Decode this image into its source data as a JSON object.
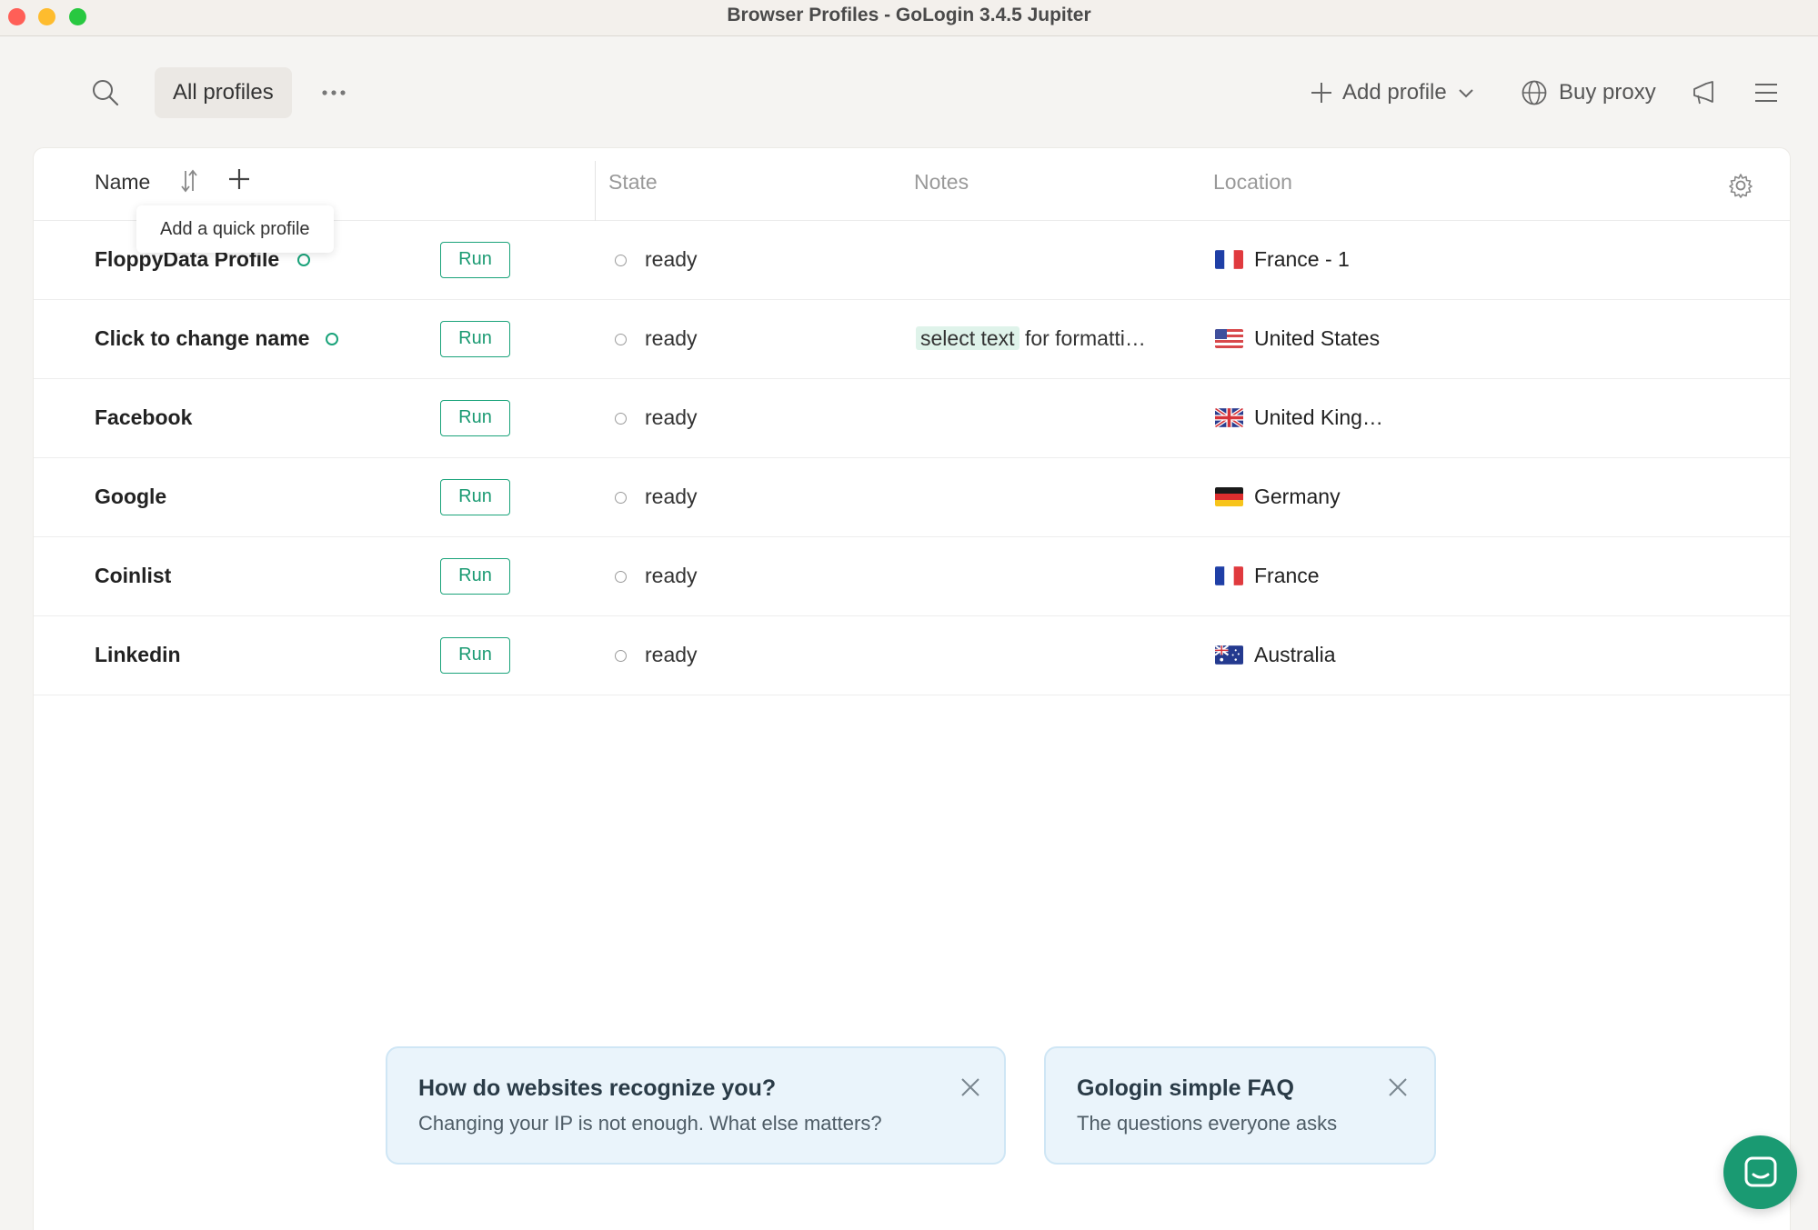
{
  "window": {
    "title": "Browser Profiles - GoLogin 3.4.5 Jupiter"
  },
  "toolbar": {
    "filter_label": "All profiles",
    "add_profile_label": "Add profile",
    "buy_proxy_label": "Buy proxy"
  },
  "table": {
    "columns": {
      "name": "Name",
      "state": "State",
      "notes": "Notes",
      "location": "Location"
    },
    "tooltip": "Add a quick profile",
    "rows": [
      {
        "name": "FloppyData Profile",
        "online": true,
        "run": "Run",
        "state": "ready",
        "notes_highlight": "",
        "notes_rest": "",
        "flag": "fr",
        "location": "France - 1"
      },
      {
        "name": "Click to change name",
        "online": true,
        "run": "Run",
        "state": "ready",
        "notes_highlight": "select text",
        "notes_rest": "for formatti…",
        "flag": "us",
        "location": "United States"
      },
      {
        "name": "Facebook",
        "online": false,
        "run": "Run",
        "state": "ready",
        "notes_highlight": "",
        "notes_rest": "",
        "flag": "gb",
        "location": "United King…"
      },
      {
        "name": "Google",
        "online": false,
        "run": "Run",
        "state": "ready",
        "notes_highlight": "",
        "notes_rest": "",
        "flag": "de",
        "location": "Germany"
      },
      {
        "name": "Coinlist",
        "online": false,
        "run": "Run",
        "state": "ready",
        "notes_highlight": "",
        "notes_rest": "",
        "flag": "fr",
        "location": "France"
      },
      {
        "name": "Linkedin",
        "online": false,
        "run": "Run",
        "state": "ready",
        "notes_highlight": "",
        "notes_rest": "",
        "flag": "au",
        "location": "Australia"
      }
    ]
  },
  "promos": [
    {
      "title": "How do websites recognize you?",
      "subtitle": "Changing your IP is not enough. What else matters?"
    },
    {
      "title": "Gologin simple FAQ",
      "subtitle": "The questions everyone asks"
    }
  ],
  "colors": {
    "accent": "#1aa37a",
    "promo_bg": "#eaf4fb"
  }
}
